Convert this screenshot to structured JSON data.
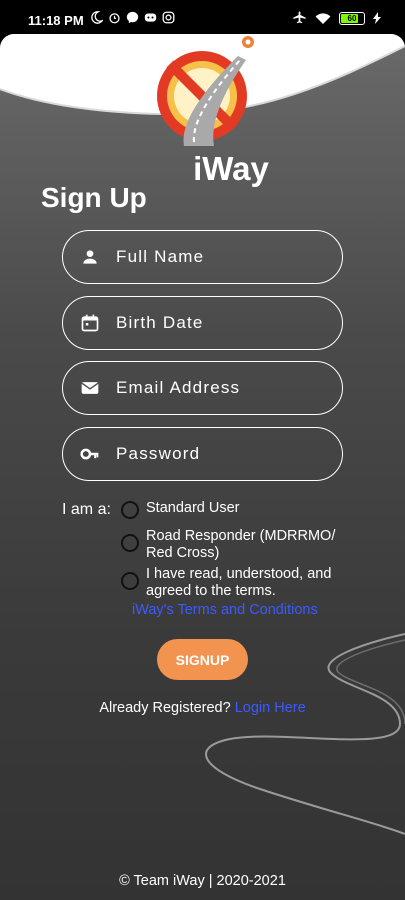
{
  "status_bar": {
    "time": "11:18 PM",
    "battery_level": "60"
  },
  "app": {
    "name": "iWay"
  },
  "page": {
    "title": "Sign Up"
  },
  "form": {
    "full_name_placeholder": "Full Name",
    "birth_date_placeholder": "Birth Date",
    "email_placeholder": "Email Address",
    "password_placeholder": "Password"
  },
  "role": {
    "label": "I am a:",
    "options": [
      {
        "label": "Standard User"
      },
      {
        "label": "Road Responder (MDRRMO/ Red Cross)"
      }
    ]
  },
  "terms": {
    "agree_label": "I have read, understood, and agreed to the terms.",
    "link_text": "iWay's Terms and Conditions"
  },
  "actions": {
    "signup_label": "SIGNUP",
    "already_registered": "Already Registered?",
    "login_link": "Login Here"
  },
  "footer": {
    "text": "© Team iWay | 2020-2021"
  },
  "colors": {
    "accent_button": "#f2944f",
    "link": "#3a5cff",
    "logo_red": "#e23a23",
    "background_top": "#6a6a6a",
    "background_bottom": "#333333"
  }
}
